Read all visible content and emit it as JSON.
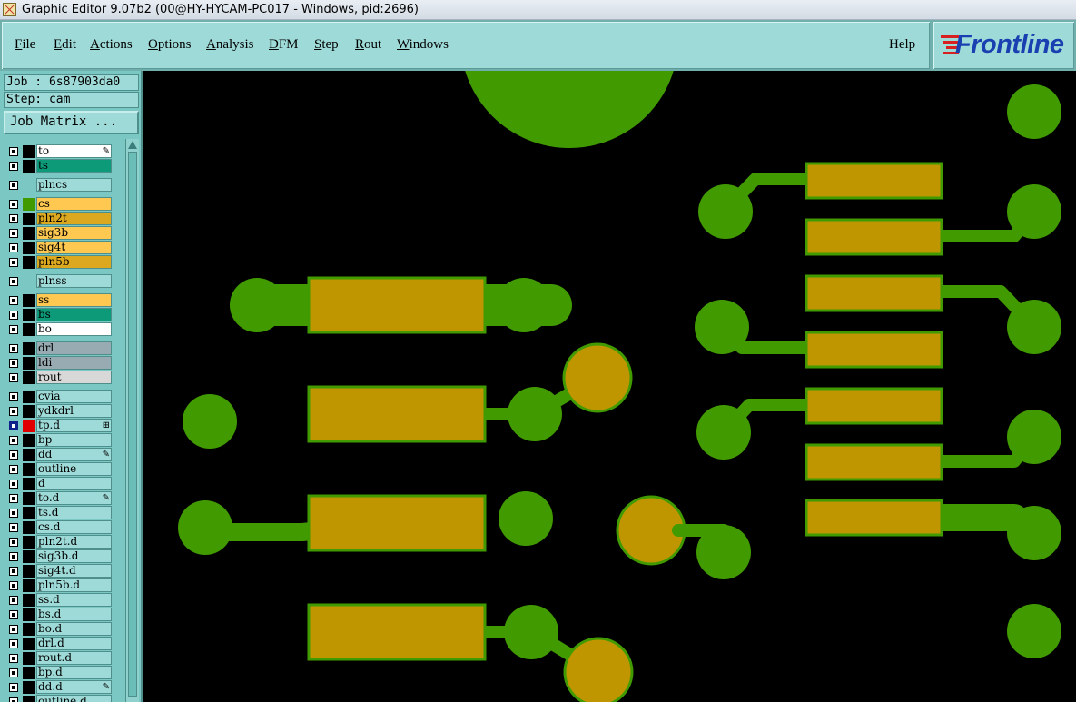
{
  "window": {
    "title": "Graphic Editor 9.07b2 (00@HY-HYCAM-PC017 - Windows, pid:2696)"
  },
  "menu": [
    {
      "label": "File",
      "ul": "F",
      "rest": "ile"
    },
    {
      "label": "Edit",
      "ul": "E",
      "rest": "dit"
    },
    {
      "label": "Actions",
      "ul": "A",
      "rest": "ctions"
    },
    {
      "label": "Options",
      "ul": "O",
      "rest": "ptions"
    },
    {
      "label": "Analysis",
      "ul": "A",
      "rest": "nalysis"
    },
    {
      "label": "DFM",
      "ul": "D",
      "rest": "FM"
    },
    {
      "label": "Step",
      "ul": "S",
      "rest": "tep"
    },
    {
      "label": "Rout",
      "ul": "R",
      "rest": "out"
    },
    {
      "label": "Windows",
      "ul": "W",
      "rest": "indows"
    }
  ],
  "help_label": "Help",
  "logo_text": "Frontline",
  "job_label": "Job : 6s87903da0",
  "step_label": "Step: cam",
  "job_matrix_label": "Job Matrix ...",
  "colors": {
    "pad_green": "#409a00",
    "pad_gold": "#bf9600",
    "pad_gold_outline": "#409a00",
    "background": "#000000",
    "panel_cyan": "#9edbd8"
  },
  "layers": [
    {
      "name": "to",
      "swatch": "#000000",
      "bg": "#ffffff",
      "mark": "pen"
    },
    {
      "name": "ts",
      "swatch": "#000000",
      "bg": "#0c9a78"
    },
    {
      "name": "plncs",
      "swatch": "",
      "bg": "#9edbd8"
    },
    {
      "name": "cs",
      "swatch": "#409a00",
      "bg": "#ffc850"
    },
    {
      "name": "pln2t",
      "swatch": "#000000",
      "bg": "#dca820"
    },
    {
      "name": "sig3b",
      "swatch": "#000000",
      "bg": "#ffc850"
    },
    {
      "name": "sig4t",
      "swatch": "#000000",
      "bg": "#ffc850"
    },
    {
      "name": "pln5b",
      "swatch": "#000000",
      "bg": "#dca820"
    },
    {
      "name": "plnss",
      "swatch": "",
      "bg": "#9edbd8"
    },
    {
      "name": "ss",
      "swatch": "#000000",
      "bg": "#ffc850"
    },
    {
      "name": "bs",
      "swatch": "#000000",
      "bg": "#0c9a78"
    },
    {
      "name": "bo",
      "swatch": "#000000",
      "bg": "#ffffff"
    },
    {
      "name": "drl",
      "swatch": "#000000",
      "bg": "#98aab2"
    },
    {
      "name": "ldi",
      "swatch": "#000000",
      "bg": "#98aab2"
    },
    {
      "name": "rout",
      "swatch": "#000000",
      "bg": "#d8d8d8"
    },
    {
      "name": "cvia",
      "swatch": "#000000",
      "bg": "#9edbd8"
    },
    {
      "name": "ydkdrl",
      "swatch": "#000000",
      "bg": "#9edbd8"
    },
    {
      "name": "tp.d",
      "swatch": "#e00000",
      "bg": "#9edbd8",
      "mark": "grid",
      "active": true
    },
    {
      "name": "bp",
      "swatch": "#000000",
      "bg": "#9edbd8"
    },
    {
      "name": "dd",
      "swatch": "#000000",
      "bg": "#9edbd8",
      "mark": "pen"
    },
    {
      "name": "outline",
      "swatch": "#000000",
      "bg": "#9edbd8"
    },
    {
      "name": "d",
      "swatch": "#000000",
      "bg": "#9edbd8"
    },
    {
      "name": "to.d",
      "swatch": "#000000",
      "bg": "#9edbd8",
      "mark": "pen"
    },
    {
      "name": "ts.d",
      "swatch": "#000000",
      "bg": "#9edbd8"
    },
    {
      "name": "cs.d",
      "swatch": "#000000",
      "bg": "#9edbd8"
    },
    {
      "name": "pln2t.d",
      "swatch": "#000000",
      "bg": "#9edbd8"
    },
    {
      "name": "sig3b.d",
      "swatch": "#000000",
      "bg": "#9edbd8"
    },
    {
      "name": "sig4t.d",
      "swatch": "#000000",
      "bg": "#9edbd8"
    },
    {
      "name": "pln5b.d",
      "swatch": "#000000",
      "bg": "#9edbd8"
    },
    {
      "name": "ss.d",
      "swatch": "#000000",
      "bg": "#9edbd8"
    },
    {
      "name": "bs.d",
      "swatch": "#000000",
      "bg": "#9edbd8"
    },
    {
      "name": "bo.d",
      "swatch": "#000000",
      "bg": "#9edbd8"
    },
    {
      "name": "drl.d",
      "swatch": "#000000",
      "bg": "#9edbd8"
    },
    {
      "name": "rout.d",
      "swatch": "#000000",
      "bg": "#9edbd8"
    },
    {
      "name": "bp.d",
      "swatch": "#000000",
      "bg": "#9edbd8"
    },
    {
      "name": "dd.d",
      "swatch": "#000000",
      "bg": "#9edbd8",
      "mark": "pen"
    },
    {
      "name": "outline.d",
      "swatch": "#000000",
      "bg": "#9edbd8"
    }
  ]
}
